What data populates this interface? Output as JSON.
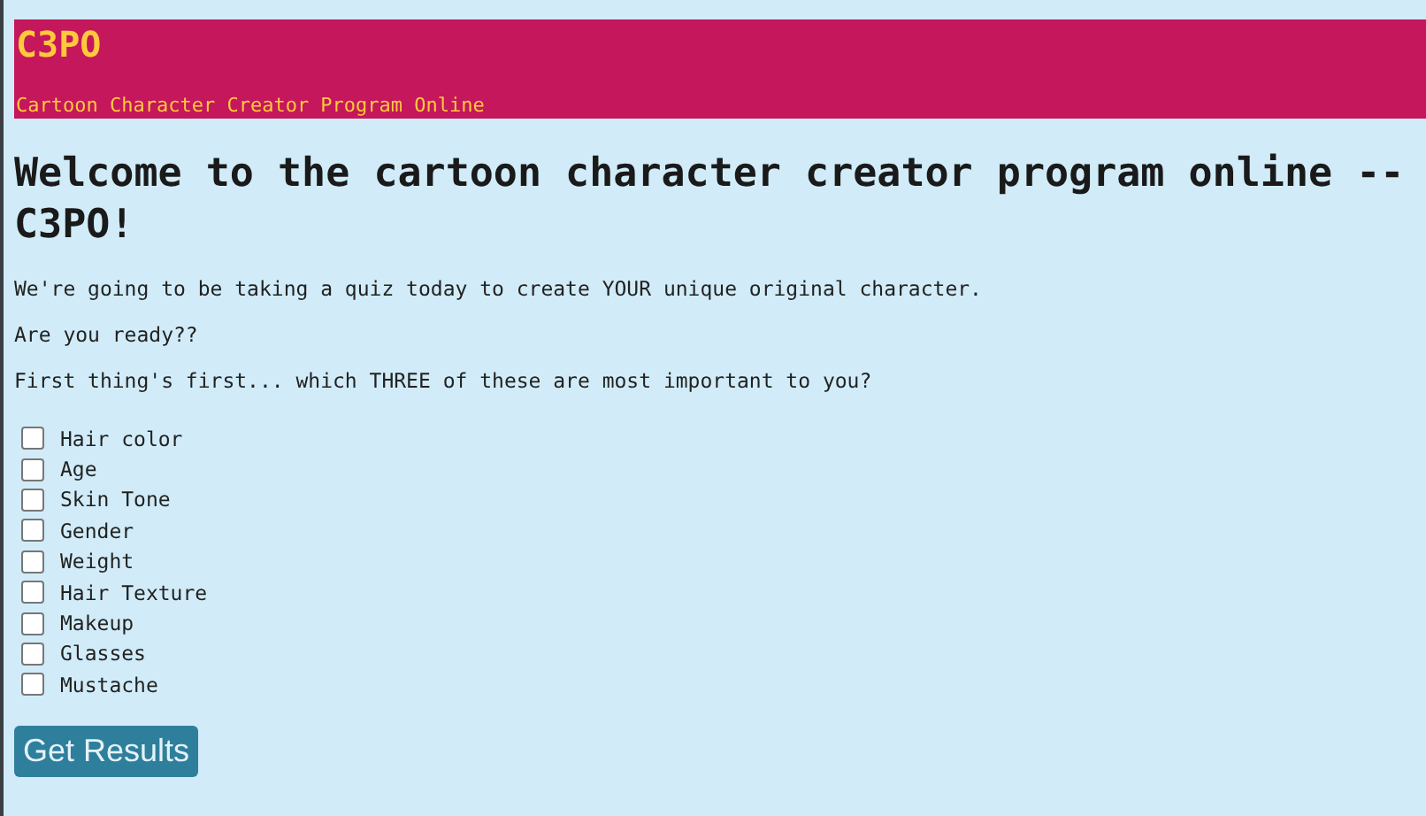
{
  "header": {
    "title": "C3PO",
    "subtitle": "Cartoon Character Creator Program Online"
  },
  "heading": "Welcome to the cartoon character creator program online -- C3PO!",
  "paragraphs": [
    "We're going to be taking a quiz today to create YOUR unique original character.",
    "Are you ready??",
    "First thing's first... which THREE of these are most important to you?"
  ],
  "options": [
    {
      "label": "Hair color",
      "checked": false
    },
    {
      "label": "Age",
      "checked": false
    },
    {
      "label": "Skin Tone",
      "checked": false
    },
    {
      "label": "Gender",
      "checked": false
    },
    {
      "label": "Weight",
      "checked": false
    },
    {
      "label": "Hair Texture",
      "checked": false
    },
    {
      "label": "Makeup",
      "checked": false
    },
    {
      "label": "Glasses",
      "checked": false
    },
    {
      "label": "Mustache",
      "checked": false
    }
  ],
  "button": "Get Results"
}
